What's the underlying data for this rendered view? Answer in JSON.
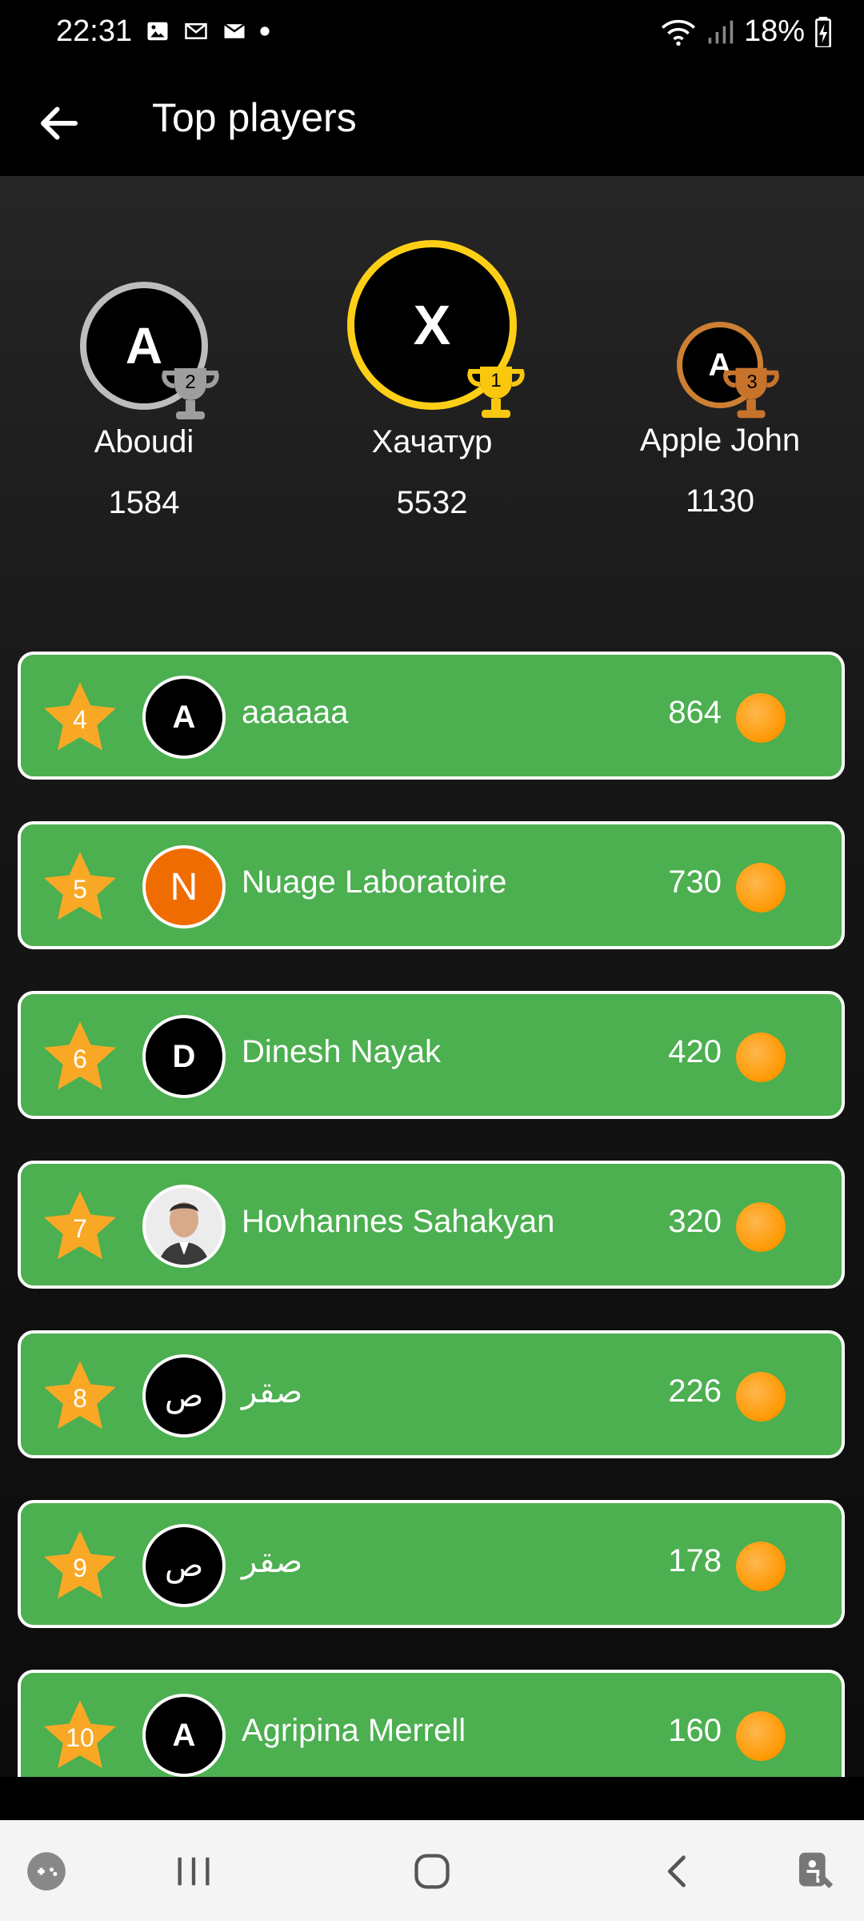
{
  "status_bar": {
    "time": "22:31",
    "battery": "18%",
    "icons": [
      "gallery-icon",
      "gmail-icon",
      "mail-icon",
      "dot-icon",
      "wifi-icon",
      "signal-icon",
      "battery-charging-icon"
    ]
  },
  "app_bar": {
    "title": "Top players",
    "back_icon": "arrow-left-icon"
  },
  "podium": [
    {
      "rank": "2",
      "initial": "A",
      "name": "Aboudi",
      "score": "1584",
      "ring_color": "#bdbdbd"
    },
    {
      "rank": "1",
      "initial": "X",
      "name": "Хачатур",
      "score": "5532",
      "ring_color": "#fdd017"
    },
    {
      "rank": "3",
      "initial": "A",
      "name": "Apple John",
      "score": "1130",
      "ring_color": "#cd7f32"
    }
  ],
  "players": [
    {
      "rank": "4",
      "initial": "A",
      "name": "aaaaaa",
      "score": "864",
      "avatar_color": "#000000"
    },
    {
      "rank": "5",
      "initial": "N",
      "name": "Nuage Laboratoire",
      "score": "730",
      "avatar_color": "#ef6c00"
    },
    {
      "rank": "6",
      "initial": "D",
      "name": "Dinesh Nayak",
      "score": "420",
      "avatar_color": "#000000"
    },
    {
      "rank": "7",
      "initial": "",
      "name": "Hovhannes Sahakyan",
      "score": "320",
      "avatar_color": "#e0e0e0"
    },
    {
      "rank": "8",
      "initial": "ص",
      "name": "صقر",
      "score": "226",
      "avatar_color": "#000000"
    },
    {
      "rank": "9",
      "initial": "ص",
      "name": "صقر",
      "score": "178",
      "avatar_color": "#000000"
    },
    {
      "rank": "10",
      "initial": "A",
      "name": "Agripina Merrell",
      "score": "160",
      "avatar_color": "#000000"
    }
  ],
  "colors": {
    "row_bg": "#4caf50",
    "star": "#f9a825",
    "coin": "#ff9800"
  },
  "nav_bar": {
    "icons": [
      "game-launcher-icon",
      "recents-icon",
      "home-icon",
      "back-icon",
      "accessibility-icon"
    ]
  }
}
